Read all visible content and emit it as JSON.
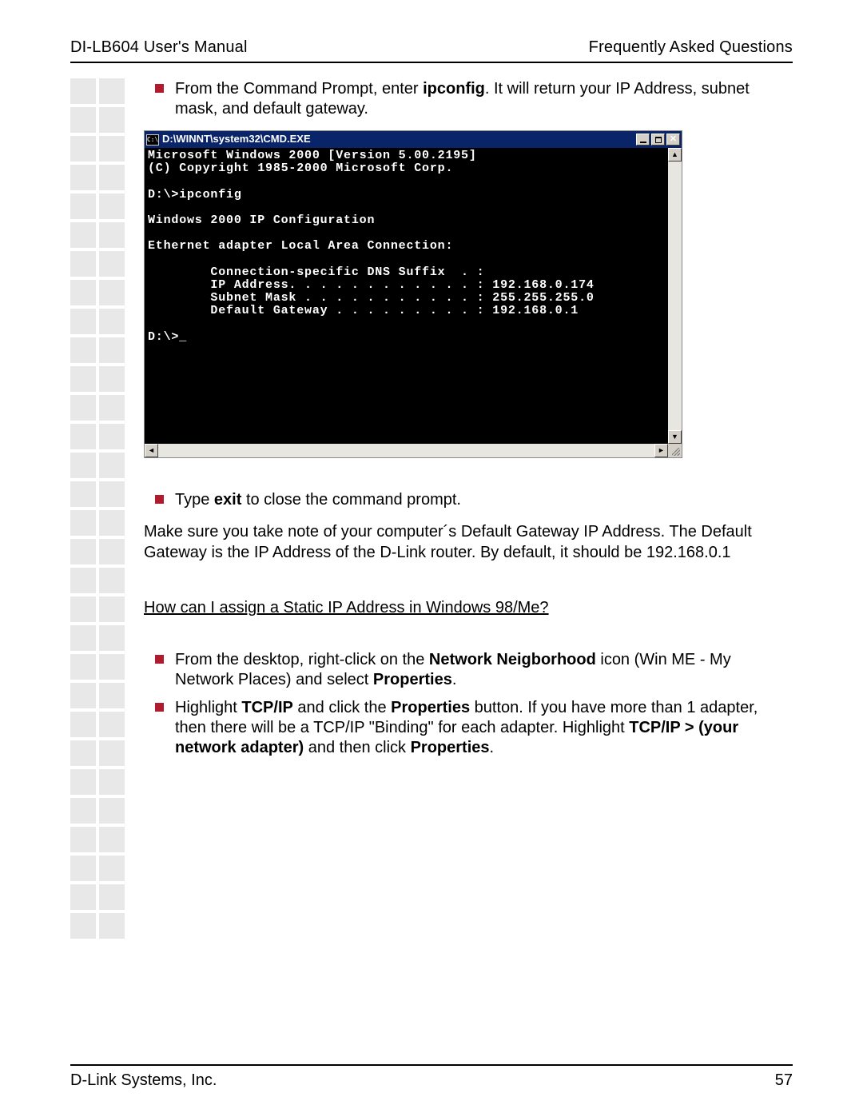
{
  "header": {
    "left": "DI-LB604 User's Manual",
    "right": "Frequently Asked Questions"
  },
  "bullet1": {
    "pre": "From the Command Prompt, enter ",
    "bold": "ipconfig",
    "post": ". It will return your IP Address, subnet mask, and default gateway."
  },
  "cmd": {
    "icon_text": "C:\\",
    "title": "D:\\WINNT\\system32\\CMD.EXE",
    "lines": [
      "Microsoft Windows 2000 [Version 5.00.2195]",
      "(C) Copyright 1985-2000 Microsoft Corp.",
      "",
      "D:\\>ipconfig",
      "",
      "Windows 2000 IP Configuration",
      "",
      "Ethernet adapter Local Area Connection:",
      "",
      "        Connection-specific DNS Suffix  . :",
      "        IP Address. . . . . . . . . . . . : 192.168.0.174",
      "        Subnet Mask . . . . . . . . . . . : 255.255.255.0",
      "        Default Gateway . . . . . . . . . : 192.168.0.1",
      "",
      "D:\\>_"
    ]
  },
  "bullet2": {
    "pre": "Type ",
    "bold": "exit",
    "post": " to close the command prompt."
  },
  "para1": "Make sure you take note of your computer´s Default Gateway IP Address. The Default Gateway is the IP Address of the D-Link router. By default, it should be 192.168.0.1",
  "subhead": "How can I assign a Static IP Address in Windows 98/Me?",
  "bullet3": {
    "p1": "From the desktop, right-click on the ",
    "b1": "Network Neigborhood",
    "p2": " icon (Win ME - My Network Places) and select ",
    "b2": "Properties",
    "p3": "."
  },
  "bullet4": {
    "p1": "Highlight ",
    "b1": "TCP/IP",
    "p2": " and click the ",
    "b2": "Properties",
    "p3": " button. If you have more than 1 adapter, then there will be a TCP/IP \"Binding\" for each adapter. Highlight ",
    "b3": "TCP/IP > (your network adapter)",
    "p4": " and then click ",
    "b4": "Properties",
    "p5": "."
  },
  "footer": {
    "left": "D-Link Systems, Inc.",
    "right": "57"
  },
  "scroll": {
    "up": "▲",
    "down": "▼",
    "left": "◄",
    "right": "►"
  }
}
